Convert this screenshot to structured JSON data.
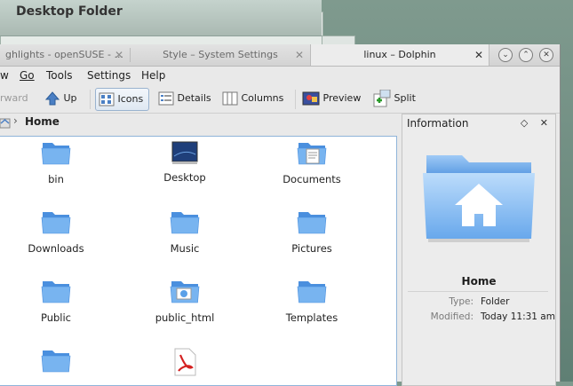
{
  "desktop": {
    "folder_title": "Desktop Folder"
  },
  "window": {
    "tabs": [
      {
        "label": "ghlights - openSUSE - ..."
      },
      {
        "label": "Style – System Settings"
      },
      {
        "label": "linux – Dolphin"
      }
    ],
    "controls": {
      "menu": "⌄",
      "minimize": "⌃",
      "close": "✕"
    }
  },
  "menubar": [
    {
      "label": "w",
      "underline": ""
    },
    {
      "label": "Go"
    },
    {
      "label": "Tools"
    },
    {
      "label": "Settings"
    },
    {
      "label": "Help"
    }
  ],
  "toolbar": {
    "forward": "rward",
    "up": "Up",
    "icons": "Icons",
    "details": "Details",
    "columns": "Columns",
    "preview": "Preview",
    "split": "Split"
  },
  "breadcrumb": {
    "current": "Home"
  },
  "files": [
    {
      "name": "bin",
      "icon": "folder-icon"
    },
    {
      "name": "Desktop",
      "icon": "desktop-folder-icon"
    },
    {
      "name": "Documents",
      "icon": "documents-folder-icon"
    },
    {
      "name": "Downloads",
      "icon": "folder-icon"
    },
    {
      "name": "Music",
      "icon": "folder-icon"
    },
    {
      "name": "Pictures",
      "icon": "folder-icon"
    },
    {
      "name": "Public",
      "icon": "folder-icon"
    },
    {
      "name": "public_html",
      "icon": "html-folder-icon"
    },
    {
      "name": "Templates",
      "icon": "folder-icon"
    },
    {
      "name": "",
      "icon": "folder-icon"
    },
    {
      "name": "",
      "icon": "pdf-file-icon"
    }
  ],
  "info_panel": {
    "title": "Information",
    "name": "Home",
    "type_label": "Type:",
    "type_value": "Folder",
    "modified_label": "Modified:",
    "modified_value": "Today 11:31 am"
  },
  "colors": {
    "accent": "#8fb4d9",
    "folder": "#5aa0e8"
  }
}
